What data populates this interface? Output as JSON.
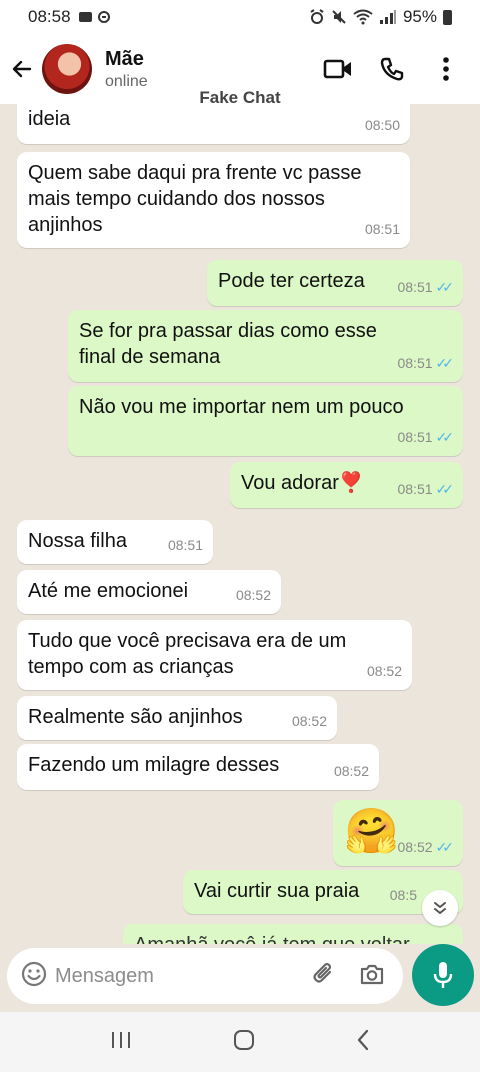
{
  "status_bar": {
    "time": "08:58",
    "battery": "95%"
  },
  "header": {
    "back_icon": "arrow-left-icon",
    "contact_name": "Mãe",
    "contact_status": "online",
    "video_icon": "video-call-icon",
    "call_icon": "phone-icon",
    "menu_icon": "more-vertical-icon"
  },
  "watermark": "Fake Chat",
  "messages": [
    {
      "dir": "in",
      "text": "ideia",
      "time": "08:50"
    },
    {
      "dir": "in",
      "text": "Quem sabe daqui pra frente vc passe mais tempo cuidando dos nossos anjinhos",
      "time": "08:51"
    },
    {
      "dir": "out",
      "text": "Pode ter certeza",
      "time": "08:51",
      "read": true
    },
    {
      "dir": "out",
      "text": "Se for pra passar dias como esse final de semana",
      "time": "08:51",
      "read": true
    },
    {
      "dir": "out",
      "text": "Não vou me importar nem um pouco",
      "time": "08:51",
      "read": true
    },
    {
      "dir": "out",
      "text": "Vou adorar❣️",
      "time": "08:51",
      "read": true
    },
    {
      "dir": "in",
      "text": "Nossa filha",
      "time": "08:51"
    },
    {
      "dir": "in",
      "text": "Até me emocionei",
      "time": "08:52"
    },
    {
      "dir": "in",
      "text": "Tudo que você precisava era de um tempo com as crianças",
      "time": "08:52"
    },
    {
      "dir": "in",
      "text": "Realmente são anjinhos",
      "time": "08:52"
    },
    {
      "dir": "in",
      "text": "Fazendo um milagre desses",
      "time": "08:52"
    },
    {
      "dir": "out",
      "text": "🤗",
      "time": "08:52",
      "read": true
    },
    {
      "dir": "out",
      "text": "Vai curtir sua praia",
      "time": "08:5"
    },
    {
      "dir": "out",
      "text": "Amanhã você já tem que voltar",
      "time": ""
    }
  ],
  "composer": {
    "placeholder": "Mensagem",
    "emoji_icon": "emoji-icon",
    "attach_icon": "paperclip-icon",
    "camera_icon": "camera-icon",
    "mic_icon": "microphone-icon"
  },
  "colors": {
    "incoming": "#ffffff",
    "outgoing": "#dcf8c6",
    "accent": "#0b9a83",
    "read_ticks": "#4fb6ec"
  }
}
